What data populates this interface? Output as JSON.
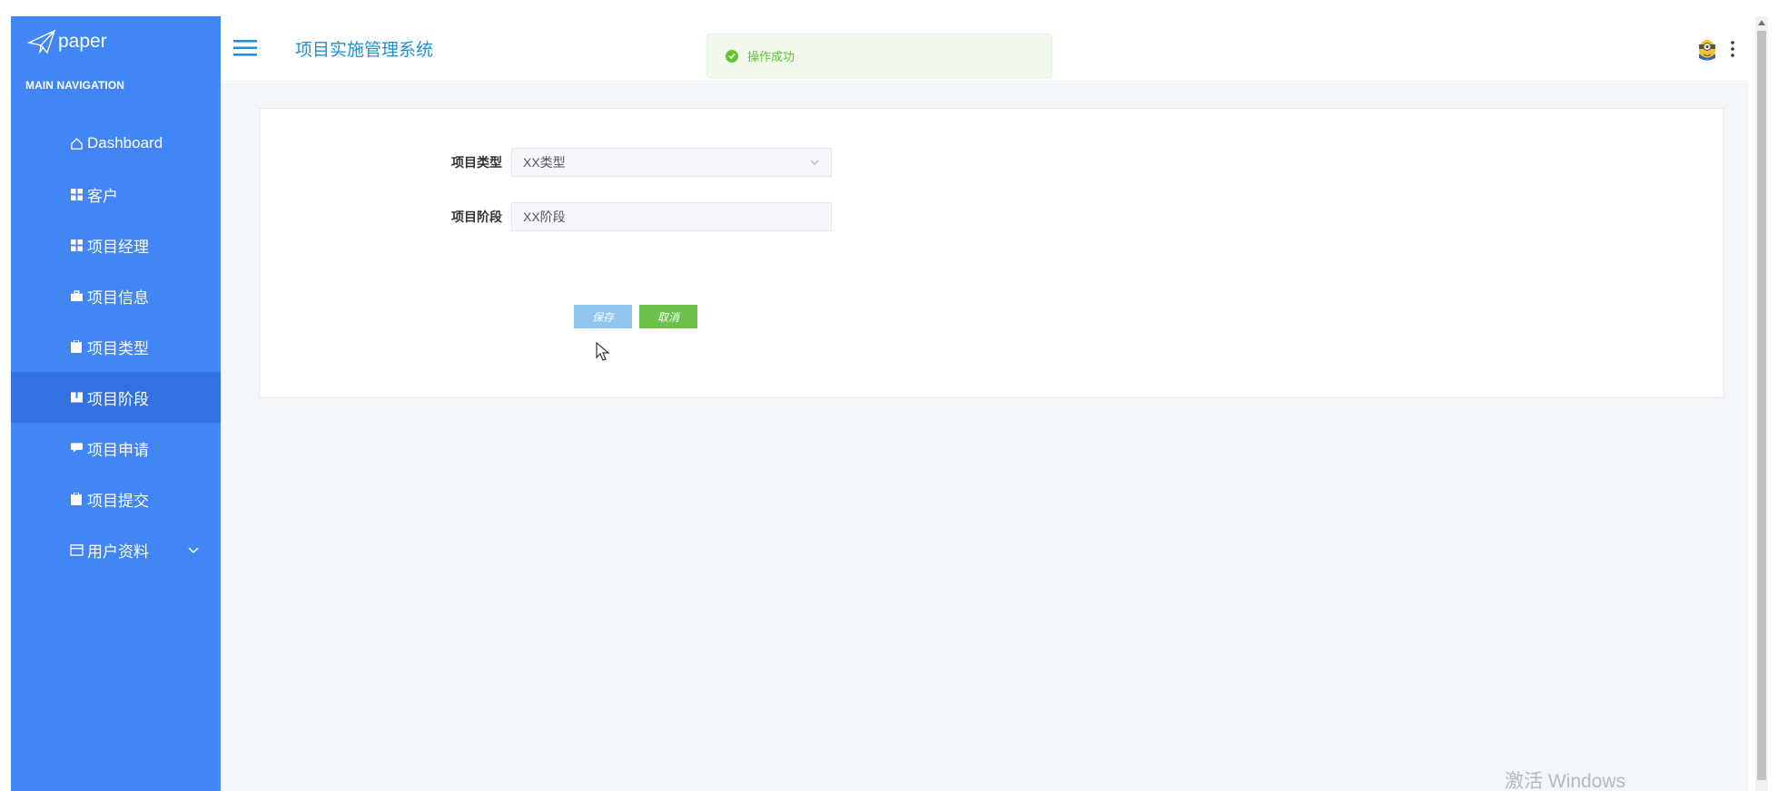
{
  "brand": {
    "name": "paper"
  },
  "sidebar": {
    "caption": "MAIN NAVIGATION",
    "items": [
      {
        "label": "Dashboard",
        "icon": "home-icon"
      },
      {
        "label": "客户",
        "icon": "grid-icon"
      },
      {
        "label": "项目经理",
        "icon": "grid-icon"
      },
      {
        "label": "项目信息",
        "icon": "briefcase-icon"
      },
      {
        "label": "项目类型",
        "icon": "clipboard-icon"
      },
      {
        "label": "项目阶段",
        "icon": "book-icon",
        "active": true
      },
      {
        "label": "项目申请",
        "icon": "comment-icon"
      },
      {
        "label": "项目提交",
        "icon": "clipboard-icon"
      },
      {
        "label": "用户资料",
        "icon": "card-icon",
        "has_children": true
      }
    ]
  },
  "header": {
    "title": "项目实施管理系统"
  },
  "toast": {
    "message": "操作成功"
  },
  "form": {
    "type_label": "项目类型",
    "type_value": "XX类型",
    "stage_label": "项目阶段",
    "stage_value": "XX阶段",
    "save_label": "保存",
    "cancel_label": "取消"
  },
  "watermark": {
    "text": "激活 Windows"
  },
  "colors": {
    "sidebar": "#4285f4",
    "active": "#3272e0",
    "accent": "#1f8fd8",
    "success": "#67c23a"
  }
}
